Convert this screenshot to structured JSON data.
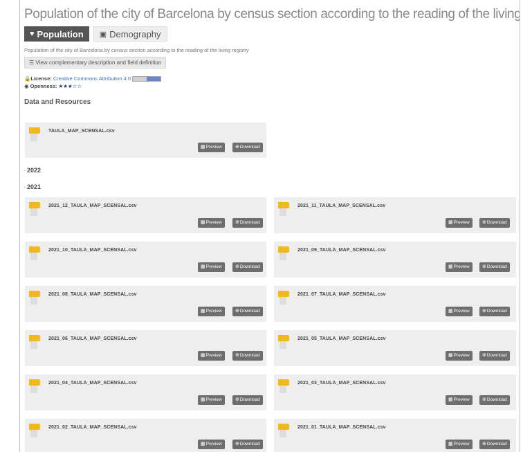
{
  "page": {
    "title": "Population of the city of Barcelona by census section according to the reading of the living registry",
    "tabs": [
      {
        "label": "Population",
        "icon": "heart-icon"
      },
      {
        "label": "Demography",
        "icon": "image-icon"
      }
    ],
    "description": "Population of the city of Barcelona by census section according to the reading of the living registry",
    "complement_button": "View complementary description and field definition",
    "license_label": "License:",
    "license_value": "Creative Commons Attribution 4.0",
    "openness_label": "Openness:",
    "openness_stars": "★★★☆☆",
    "section_heading": "Data and Resources"
  },
  "buttons": {
    "preview": "Preview",
    "download": "Download"
  },
  "main_resource": {
    "file": "TAULA_MAP_SCENSAL.csv"
  },
  "years": [
    {
      "label": "2022"
    },
    {
      "label": "2021"
    }
  ],
  "resources_2021": [
    {
      "file": "2021_12_TAULA_MAP_SCENSAL.csv"
    },
    {
      "file": "2021_11_TAULA_MAP_SCENSAL.csv"
    },
    {
      "file": "2021_10_TAULA_MAP_SCENSAL.csv"
    },
    {
      "file": "2021_09_TAULA_MAP_SCENSAL.csv"
    },
    {
      "file": "2021_08_TAULA_MAP_SCENSAL.csv"
    },
    {
      "file": "2021_07_TAULA_MAP_SCENSAL.csv"
    },
    {
      "file": "2021_06_TAULA_MAP_SCENSAL.csv"
    },
    {
      "file": "2021_05_TAULA_MAP_SCENSAL.csv"
    },
    {
      "file": "2021_04_TAULA_MAP_SCENSAL.csv"
    },
    {
      "file": "2021_03_TAULA_MAP_SCENSAL.csv"
    },
    {
      "file": "2021_02_TAULA_MAP_SCENSAL.csv"
    },
    {
      "file": "2021_01_TAULA_MAP_SCENSAL.csv"
    }
  ],
  "colors": {
    "accent_flag": "#f0b91e",
    "tab_active": "#555555",
    "button": "#6e6e6e",
    "link": "#3a6fb0"
  }
}
